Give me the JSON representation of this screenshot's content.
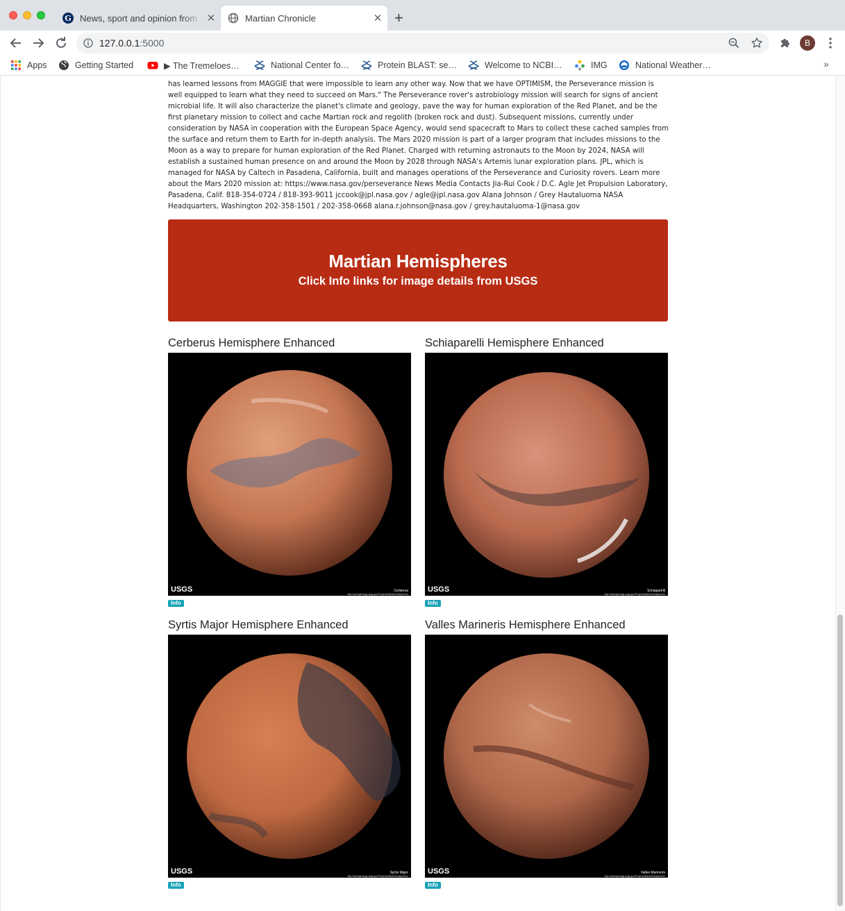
{
  "browser": {
    "tabs": [
      {
        "title": "News, sport and opinion from the Guardian's US edition",
        "icon": "guardian-icon"
      },
      {
        "title": "Martian Chronicle",
        "icon": "globe-icon"
      }
    ],
    "url_host": "127.0.0.1",
    "url_port": ":5000",
    "profile_initial": "B",
    "bookmarks": [
      {
        "label": "Apps",
        "icon": "apps-grid-icon"
      },
      {
        "label": "Getting Started",
        "icon": "globe-icon"
      },
      {
        "label": "▶ The Tremeloes…",
        "icon": "youtube-icon"
      },
      {
        "label": "National Center fo…",
        "icon": "ncbi-helix-icon"
      },
      {
        "label": "Protein BLAST: se…",
        "icon": "ncbi-helix-icon"
      },
      {
        "label": "Welcome to NCBI…",
        "icon": "ncbi-helix-icon"
      },
      {
        "label": "IMG",
        "icon": "img-dots-icon"
      },
      {
        "label": "National Weather…",
        "icon": "noaa-icon"
      }
    ],
    "bookmarks_more": "»"
  },
  "article": {
    "text": "has learned lessons from MAGGIE that were impossible to learn any other way. Now that we have OPTIMISM, the Perseverance mission is well equipped to learn what they need to succeed on Mars.\" The Perseverance rover's astrobiology mission will search for signs of ancient microbial life. It will also characterize the planet's climate and geology, pave the way for human exploration of the Red Planet, and be the first planetary mission to collect and cache Martian rock and regolith (broken rock and dust). Subsequent missions, currently under consideration by NASA in cooperation with the European Space Agency, would send spacecraft to Mars to collect these cached samples from the surface and return them to Earth for in-depth analysis. The Mars 2020 mission is part of a larger program that includes missions to the Moon as a way to prepare for human exploration of the Red Planet. Charged with returning astronauts to the Moon by 2024, NASA will establish a sustained human presence on and around the Moon by 2028 through NASA's Artemis lunar exploration plans. JPL, which is managed for NASA by Caltech in Pasadena, California, built and manages operations of the Perseverance and Curiosity rovers. Learn more about the Mars 2020 mission at: https://www.nasa.gov/perseverance News Media Contacts Jia-Rui Cook / D.C. Agle Jet Propulsion Laboratory, Pasadena, Calif. 818-354-0724 / 818-393-9011 jccook@jpl.nasa.gov / agle@jpl.nasa.gov Alana Johnson / Grey Hautaluoma NASA Headquarters, Washington 202-358-1501 / 202-358-0668 alana.r.johnson@nasa.gov / grey.hautaluoma-1@nasa.gov"
  },
  "jumbotron": {
    "title": "Martian Hemispheres",
    "subtitle": "Click Info links for image details from USGS",
    "color": "#b92c14"
  },
  "hemispheres": [
    {
      "title": "Cerberus Hemisphere Enhanced",
      "caption": "Cerberus",
      "info_label": "Info"
    },
    {
      "title": "Schiaparelli Hemisphere Enhanced",
      "caption": "Schiaparelli",
      "info_label": "Info"
    },
    {
      "title": "Syrtis Major Hemisphere Enhanced",
      "caption": "Syrtis Major",
      "info_label": "Info"
    },
    {
      "title": "Valles Marineris Hemisphere Enhanced",
      "caption": "Valles Marineris",
      "info_label": "Info"
    }
  ],
  "image_credit": {
    "logo": "USGS",
    "source_url": "http://astrogeology.usgs.gov/Projects/MarsHemispheres/"
  },
  "colors": {
    "info_badge": "#17a2b8",
    "mars_surface": "#c86a45"
  }
}
